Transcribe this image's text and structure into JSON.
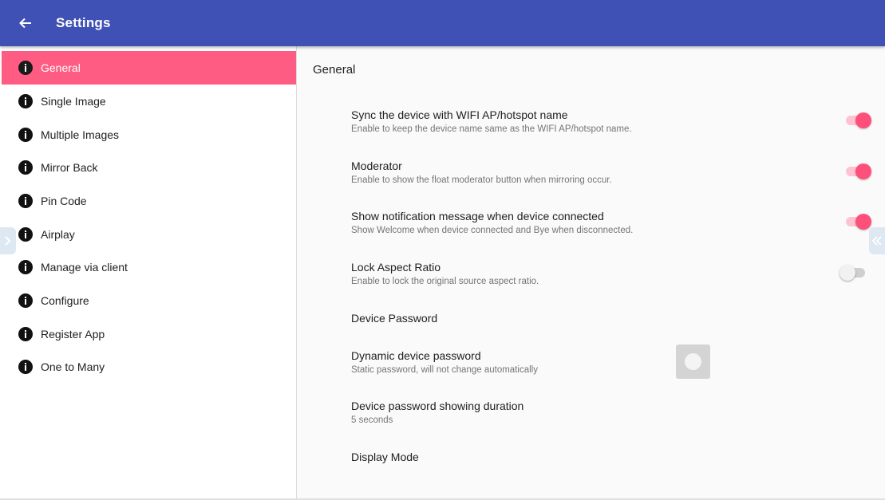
{
  "appbar": {
    "title": "Settings",
    "back_icon": "arrow-left-icon",
    "color": "#3f51b5"
  },
  "sidebar": {
    "active_color": "#ff5c83",
    "items": [
      {
        "label": "General",
        "icon": "info-icon",
        "active": true
      },
      {
        "label": "Single Image",
        "icon": "info-icon"
      },
      {
        "label": "Multiple Images",
        "icon": "info-icon"
      },
      {
        "label": "Mirror Back",
        "icon": "info-icon"
      },
      {
        "label": "Pin Code",
        "icon": "info-icon"
      },
      {
        "label": "Airplay",
        "icon": "info-icon"
      },
      {
        "label": "Manage via client",
        "icon": "info-icon"
      },
      {
        "label": "Configure",
        "icon": "info-icon"
      },
      {
        "label": "Register App",
        "icon": "info-icon"
      },
      {
        "label": "One to Many",
        "icon": "info-icon"
      }
    ]
  },
  "main": {
    "section_title": "General",
    "prefs": [
      {
        "title": "Sync the device with WIFI AP/hotspot name",
        "subtitle": "Enable to keep the device name same as the WIFI AP/hotspot name.",
        "switch": "on"
      },
      {
        "title": "Moderator",
        "subtitle": "Enable to show the float moderator button when mirroring occur.",
        "switch": "on"
      },
      {
        "title": "Show notification message when device connected",
        "subtitle": "Show Welcome when device connected and Bye when disconnected.",
        "switch": "on"
      },
      {
        "title": "Lock Aspect Ratio",
        "subtitle": "Enable to lock the original source aspect ratio.",
        "switch": "off"
      },
      {
        "title": "Device Password"
      },
      {
        "title": "Dynamic device password",
        "subtitle": "Static password, will not change automatically"
      },
      {
        "title": "Device password showing duration",
        "subtitle": "5 seconds"
      },
      {
        "title": "Display Mode"
      }
    ]
  },
  "edges": {
    "left_icon": "chevron-right-icon",
    "right_icon": "chevron-left-icon"
  }
}
